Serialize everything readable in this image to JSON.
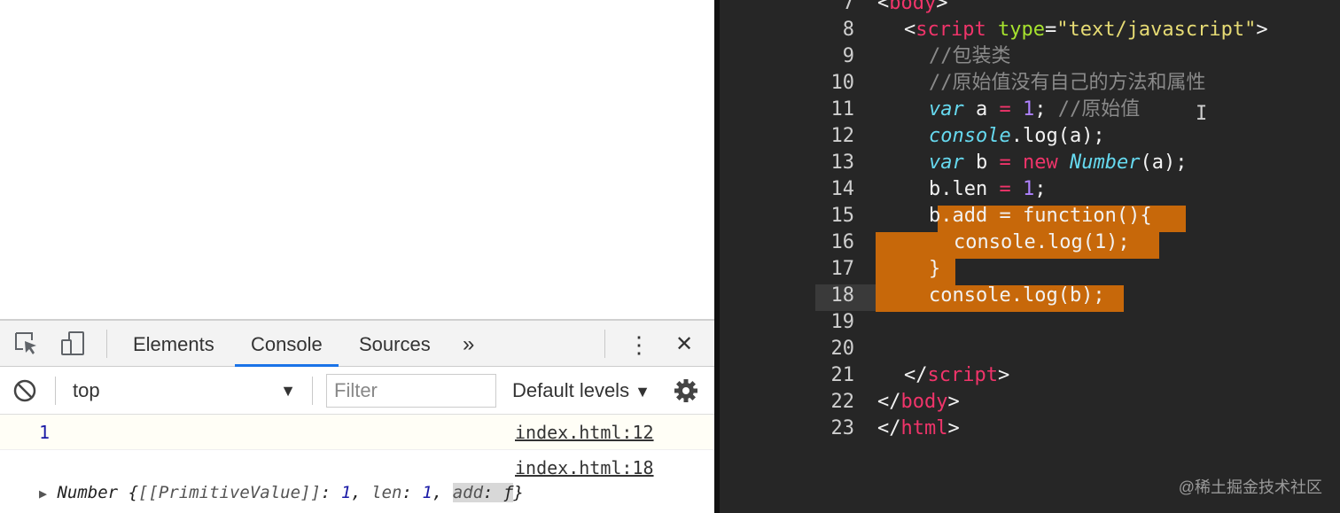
{
  "devtools": {
    "tabs": [
      {
        "label": "Elements",
        "active": false
      },
      {
        "label": "Console",
        "active": true
      },
      {
        "label": "Sources",
        "active": false
      }
    ],
    "more_tabs_label": "»",
    "kebab_label": "⋮",
    "close_label": "✕",
    "toolbar": {
      "context": "top",
      "context_arrow": "▼",
      "filter_placeholder": "Filter",
      "levels": "Default levels",
      "levels_arrow": "▼"
    },
    "console": [
      {
        "value": "1",
        "source": "index.html:12"
      },
      {
        "source": "index.html:18",
        "expander": "▶",
        "object": {
          "type": "Number",
          "open": " {",
          "k1": "[[PrimitiveValue]]",
          "v1": "1",
          "k2": "len",
          "v2": "1",
          "k3": "add",
          "v3": "ƒ",
          "close": "}",
          "colon": ": ",
          "comma": ", "
        }
      }
    ]
  },
  "editor": {
    "line_numbers": [
      "7",
      "8",
      "9",
      "10",
      "11",
      "12",
      "13",
      "14",
      "15",
      "16",
      "17",
      "18",
      "19",
      "20",
      "21",
      "22",
      "23"
    ],
    "l7": {
      "lt": "<",
      "tag": "body",
      "gt": ">"
    },
    "l8": {
      "lt": "<",
      "tag": "script",
      "attr": "type",
      "eq": "=",
      "str": "\"text/javascript\"",
      "gt": ">"
    },
    "l9": "//包装类",
    "l10": "//原始值没有自己的方法和属性",
    "l11": {
      "kw": "var",
      "rest1": " a ",
      "op": "=",
      "sp": " ",
      "num": "1",
      "semi": "; ",
      "cmt": "//原始值"
    },
    "l12": {
      "obj": "console",
      "rest": ".log(a);"
    },
    "l13": {
      "kw": "var",
      "rest1": " b ",
      "op": "=",
      "sp": " ",
      "new": "new",
      "sp2": " ",
      "cls": "Number",
      "rest2": "(a);"
    },
    "l14": {
      "a": "b.len ",
      "op": "=",
      "sp": " ",
      "num": "1",
      "semi": ";"
    },
    "l15": "b.add = function(){",
    "l16": "console.log(1);",
    "l17": "}",
    "l18": "console.log(b);",
    "l21": {
      "lt": "</",
      "tag": "script",
      "gt": ">"
    },
    "l22": {
      "lt": "</",
      "tag": "body",
      "gt": ">"
    },
    "l23": {
      "lt": "</",
      "tag": "html",
      "gt": ">"
    },
    "caret": "I"
  },
  "watermark": "@稀土掘金技术社区",
  "colors": {
    "editor_bg": "#262626",
    "selection": "#c7680a",
    "tag": "#f0346a",
    "attr": "#a6e22e",
    "string": "#e6db74",
    "keyword": "#66d9ef",
    "comment": "#8a8a8a",
    "number": "#ae81ff",
    "devtools_accent": "#1a73e8"
  },
  "icons": [
    "inspect-element-icon",
    "device-toolbar-icon",
    "clear-console-icon",
    "settings-gear-icon"
  ]
}
